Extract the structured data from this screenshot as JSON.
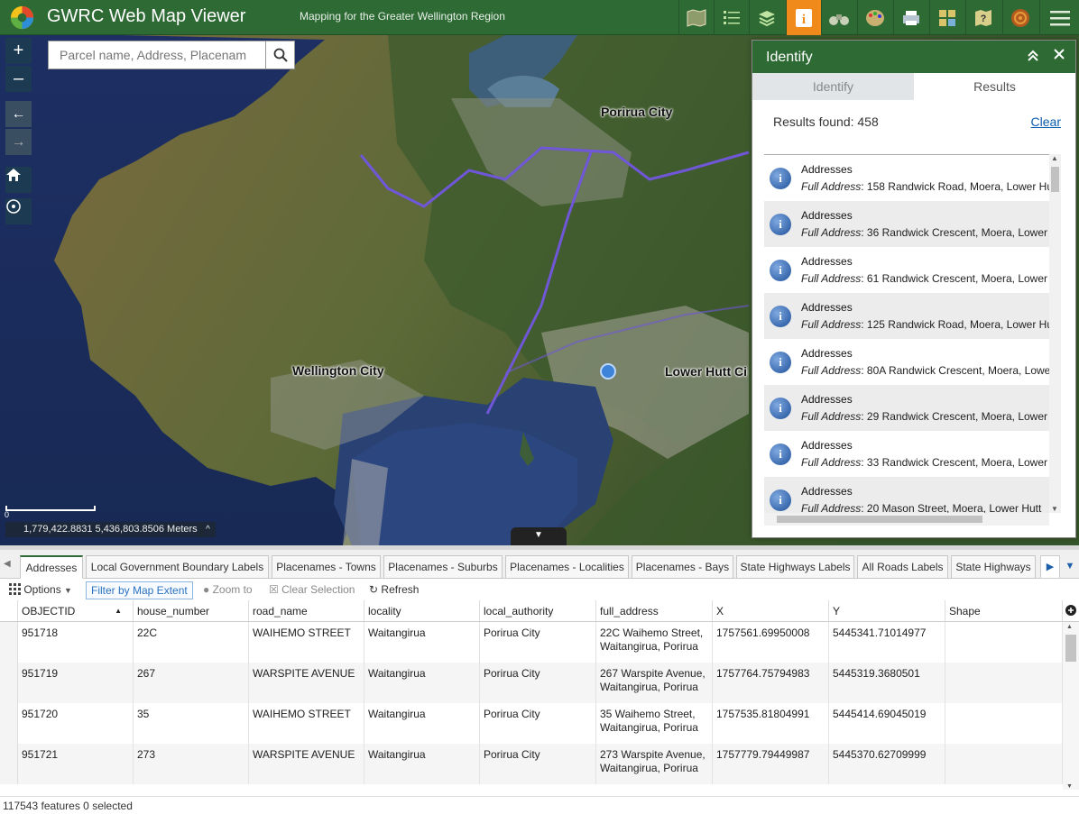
{
  "header": {
    "title": "GWRC Web Map Viewer",
    "subtitle": "Mapping for the Greater Wellington Region",
    "accent": "#2d6a34",
    "active_color": "#f08a1a",
    "buttons": [
      "basemap-icon",
      "layer-list-icon",
      "layers-icon",
      "identify-icon",
      "binoculars-icon",
      "palette-icon",
      "print-icon",
      "grid-icon",
      "help-icon",
      "globe-icon",
      "menu-icon"
    ]
  },
  "search": {
    "placeholder": "Parcel name, Address, Placenam"
  },
  "map": {
    "labels": {
      "porirua": "Porirua City",
      "wellington": "Wellington City",
      "lower_hutt": "Lower Hutt Ci"
    },
    "coordinates": "1,779,422.8831 5,436,803.8506 Meters",
    "scale_zero": "0"
  },
  "identify": {
    "title": "Identify",
    "tabs": {
      "identify": "Identify",
      "results": "Results"
    },
    "results_label": "Results found: 458",
    "clear": "Clear",
    "field_label": "Full Address",
    "items": [
      {
        "title": "Addresses",
        "address": ": 158 Randwick Road, Moera, Lower Hu"
      },
      {
        "title": "Addresses",
        "address": ": 36 Randwick Crescent, Moera, Lower"
      },
      {
        "title": "Addresses",
        "address": ": 61 Randwick Crescent, Moera, Lower"
      },
      {
        "title": "Addresses",
        "address": ": 125 Randwick Road, Moera, Lower Hu"
      },
      {
        "title": "Addresses",
        "address": ": 80A Randwick Crescent, Moera, Lowe"
      },
      {
        "title": "Addresses",
        "address": ": 29 Randwick Crescent, Moera, Lower"
      },
      {
        "title": "Addresses",
        "address": ": 33 Randwick Crescent, Moera, Lower"
      },
      {
        "title": "Addresses",
        "address": ": 20 Mason Street, Moera, Lower Hutt"
      }
    ]
  },
  "table": {
    "tabs": [
      "Addresses",
      "Local Government Boundary Labels",
      "Placenames - Towns",
      "Placenames - Suburbs",
      "Placenames - Localities",
      "Placenames - Bays",
      "State Highways Labels",
      "All Roads Labels",
      "State Highways"
    ],
    "toolbar": {
      "options": "Options",
      "filter": "Filter by Map Extent",
      "zoom": "Zoom to",
      "clear": "Clear Selection",
      "refresh": "Refresh"
    },
    "columns": [
      "OBJECTID",
      "house_number",
      "road_name",
      "locality",
      "local_authority",
      "full_address",
      "X",
      "Y",
      "Shape"
    ],
    "rows": [
      [
        "951718",
        "22C",
        "WAIHEMO STREET",
        "Waitangirua",
        "Porirua City",
        "22C Waihemo Street, Waitangirua, Porirua",
        "1757561.69950008",
        "5445341.71014977",
        ""
      ],
      [
        "951719",
        "267",
        "WARSPITE AVENUE",
        "Waitangirua",
        "Porirua City",
        "267 Warspite Avenue, Waitangirua, Porirua",
        "1757764.75794983",
        "5445319.3680501",
        ""
      ],
      [
        "951720",
        "35",
        "WAIHEMO STREET",
        "Waitangirua",
        "Porirua City",
        "35 Waihemo Street, Waitangirua, Porirua",
        "1757535.81804991",
        "5445414.69045019",
        ""
      ],
      [
        "951721",
        "273",
        "WARSPITE AVENUE",
        "Waitangirua",
        "Porirua City",
        "273 Warspite Avenue, Waitangirua, Porirua",
        "1757779.79449987",
        "5445370.62709999",
        ""
      ]
    ],
    "status": "117543 features 0 selected"
  }
}
